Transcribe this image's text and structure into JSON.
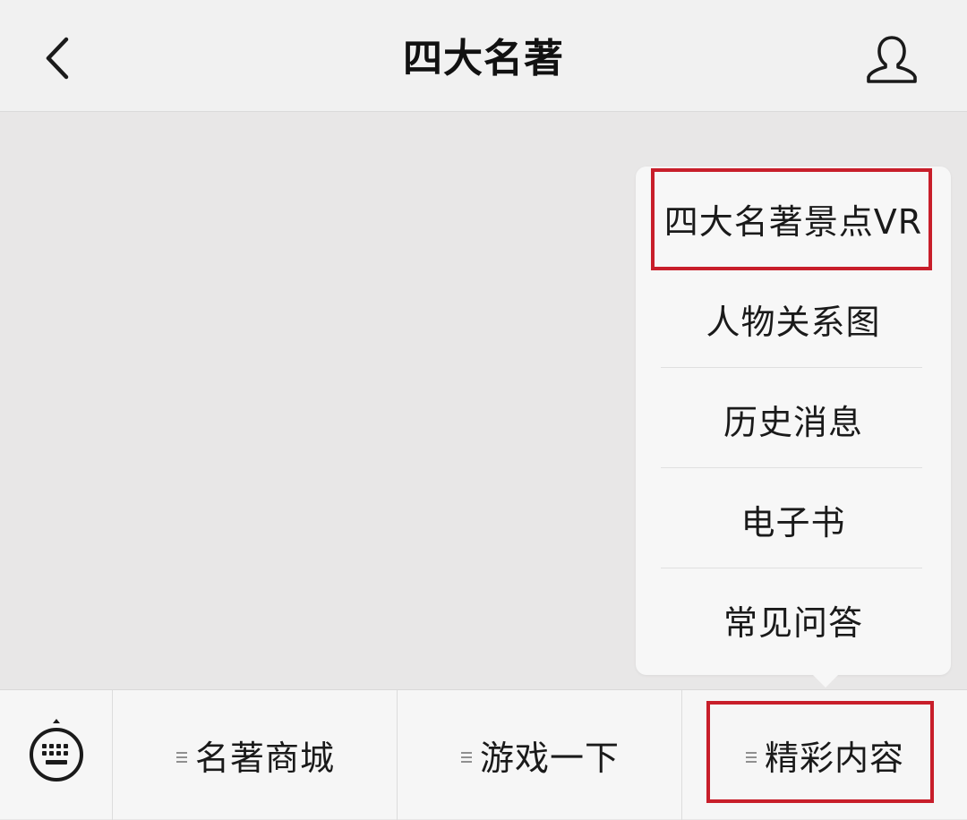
{
  "nav": {
    "back_icon": "chevron-left-icon",
    "title": "四大名著",
    "profile_icon": "person-outline-icon"
  },
  "submenu": {
    "items": [
      {
        "label": "四大名著景点VR",
        "highlighted": true
      },
      {
        "label": "人物关系图"
      },
      {
        "label": "历史消息"
      },
      {
        "label": "电子书"
      },
      {
        "label": "常见问答"
      }
    ]
  },
  "bottom_bar": {
    "keyboard_icon": "keyboard-icon",
    "menu_icon": "menu-lines-icon",
    "tabs": [
      {
        "label": "名著商城"
      },
      {
        "label": "游戏一下"
      },
      {
        "label": "精彩内容",
        "highlighted": true
      }
    ]
  },
  "colors": {
    "highlight_border": "#c81e2a",
    "nav_background": "#f1f1f1",
    "chat_background": "#e8e7e7",
    "menu_background": "#f7f7f7"
  }
}
